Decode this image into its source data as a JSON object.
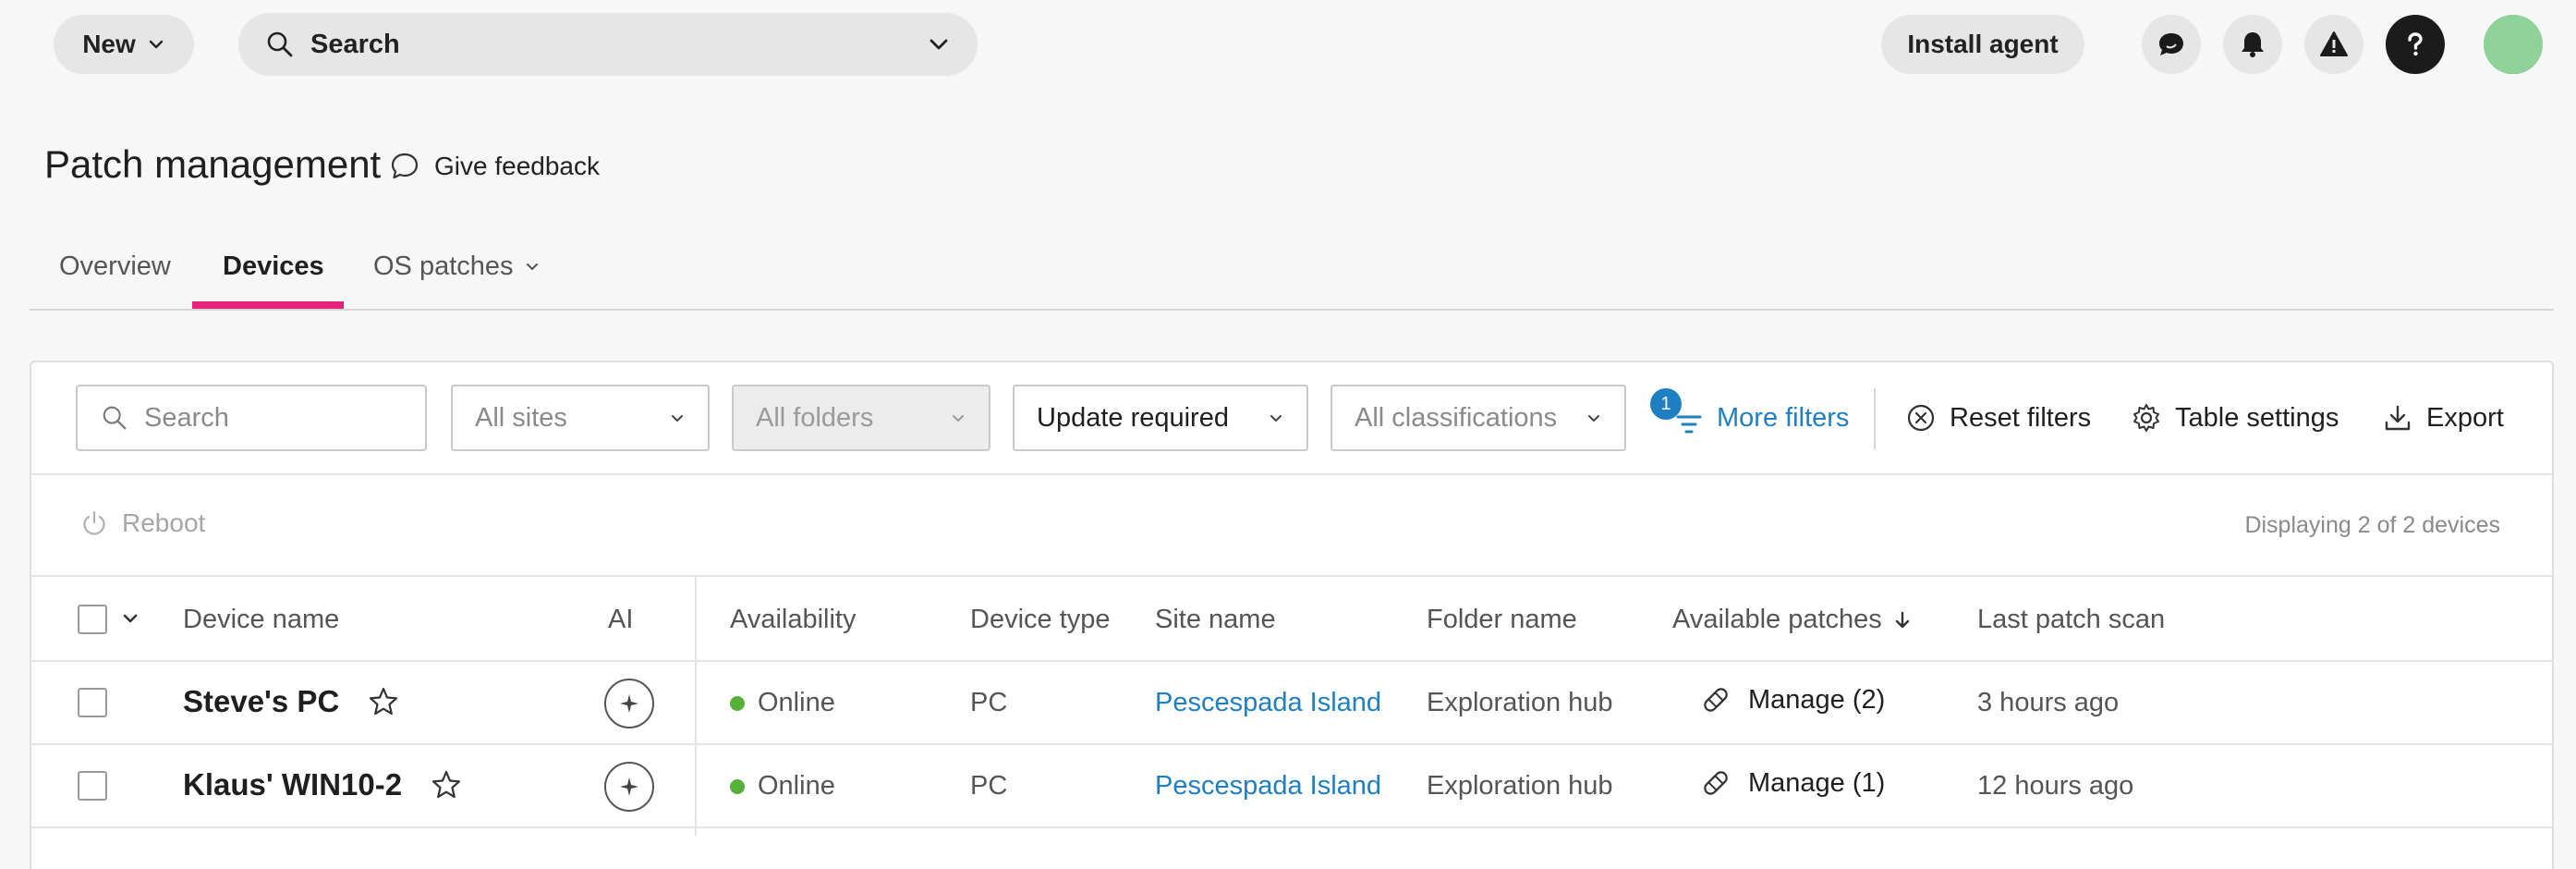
{
  "topbar": {
    "new_label": "New",
    "search_label": "Search",
    "install_label": "Install agent"
  },
  "header": {
    "title": "Patch management",
    "feedback_label": "Give feedback"
  },
  "tabs": [
    {
      "label": "Overview",
      "active": false
    },
    {
      "label": "Devices",
      "active": true
    },
    {
      "label": "OS patches",
      "active": false
    }
  ],
  "filters": {
    "search_placeholder": "Search",
    "sites": "All sites",
    "folders": "All folders",
    "status": "Update required",
    "classifications": "All classifications",
    "more_filters_label": "More filters",
    "more_filters_count": "1",
    "reset_label": "Reset filters",
    "table_settings_label": "Table settings",
    "export_label": "Export"
  },
  "actions": {
    "reboot_label": "Reboot",
    "displaying": "Displaying 2 of 2 devices"
  },
  "table": {
    "columns": {
      "device_name": "Device name",
      "ai": "AI",
      "availability": "Availability",
      "device_type": "Device type",
      "site_name": "Site name",
      "folder_name": "Folder name",
      "available_patches": "Available patches",
      "last_patch_scan": "Last patch scan"
    },
    "rows": [
      {
        "device_name": "Steve's PC",
        "availability": "Online",
        "device_type": "PC",
        "site_name": "Pescespada Island",
        "folder_name": "Exploration hub",
        "patches": "Manage (2)",
        "last_scan": "3 hours ago"
      },
      {
        "device_name": "Klaus' WIN10-2",
        "availability": "Online",
        "device_type": "PC",
        "site_name": "Pescespada Island",
        "folder_name": "Exploration hub",
        "patches": "Manage (1)",
        "last_scan": "12 hours ago"
      }
    ]
  },
  "colors": {
    "accent": "#1e7fc2",
    "tab_indicator": "#e32478",
    "online": "#58b03a"
  }
}
